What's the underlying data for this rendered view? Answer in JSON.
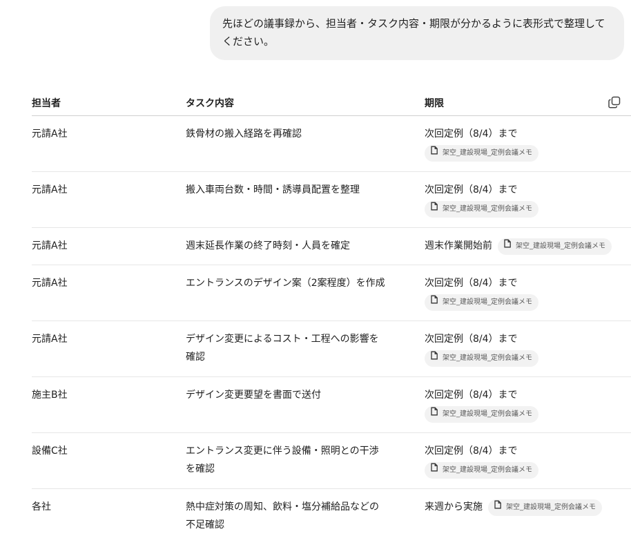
{
  "user_message": "先ほどの議事録から、担当者・タスク内容・期限が分かるように表形式で整理してください。",
  "table": {
    "headers": {
      "owner": "担当者",
      "task": "タスク内容",
      "deadline": "期限"
    },
    "rows": [
      {
        "owner": "元請A社",
        "task": "鉄骨材の搬入経路を再確認",
        "deadline": "次回定例（8/4）まで",
        "source": "架空_建設現場_定例会議メモ"
      },
      {
        "owner": "元請A社",
        "task": "搬入車両台数・時間・誘導員配置を整理",
        "deadline": "次回定例（8/4）まで",
        "source": "架空_建設現場_定例会議メモ"
      },
      {
        "owner": "元請A社",
        "task": "週末延長作業の終了時刻・人員を確定",
        "deadline": "週末作業開始前",
        "source": "架空_建設現場_定例会議メモ"
      },
      {
        "owner": "元請A社",
        "task": "エントランスのデザイン案（2案程度）を作成",
        "deadline": "次回定例（8/4）まで",
        "source": "架空_建設現場_定例会議メモ"
      },
      {
        "owner": "元請A社",
        "task": "デザイン変更によるコスト・工程への影響を確認",
        "deadline": "次回定例（8/4）まで",
        "source": "架空_建設現場_定例会議メモ"
      },
      {
        "owner": "施主B社",
        "task": "デザイン変更要望を書面で送付",
        "deadline": "次回定例（8/4）まで",
        "source": "架空_建設現場_定例会議メモ"
      },
      {
        "owner": "設備C社",
        "task": "エントランス変更に伴う設備・照明との干渉を確認",
        "deadline": "次回定例（8/4）まで",
        "source": "架空_建設現場_定例会議メモ"
      },
      {
        "owner": "各社",
        "task": "熱中症対策の周知、飲料・塩分補給品などの不足確認",
        "deadline": "来週から実施",
        "source": "架空_建設現場_定例会議メモ"
      }
    ]
  },
  "icons": {
    "copy": "copy-icon",
    "document": "document-icon"
  }
}
